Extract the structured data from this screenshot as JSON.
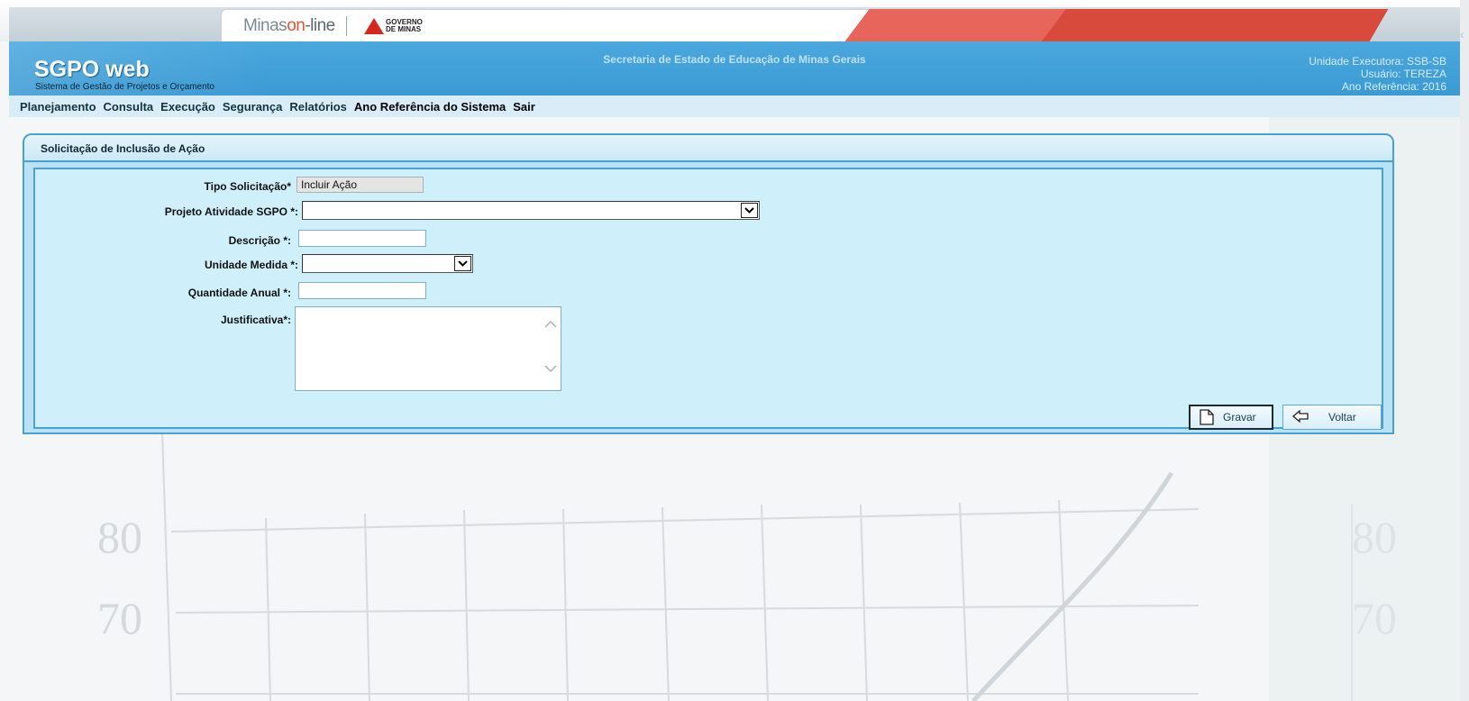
{
  "banner": {
    "portal_logo_left": "Minas",
    "portal_logo_mid": "on",
    "portal_logo_right": "-line",
    "gov_logo_line1": "GOVERNO",
    "gov_logo_line2": "DE MINAS"
  },
  "header": {
    "app_title": "SGPO web",
    "app_subtitle": "Sistema de Gestão de Projetos e Orçamento",
    "organization": "Secretaria de Estado de Educação de Minas Gerais",
    "executing_unit": "Unidade Executora: SSB-SB",
    "user": "Usuário: TEREZA",
    "reference_year": "Ano Referência: 2016"
  },
  "menu": {
    "items": [
      "Planejamento",
      "Consulta",
      "Execução",
      "Segurança",
      "Relatórios",
      "Ano Referência do Sistema",
      "Sair"
    ]
  },
  "form": {
    "title": "Solicitação de Inclusão de Ação",
    "request_type_label": "Tipo Solicitação*",
    "request_type_value": "Incluir Ação",
    "project_label": "Projeto Atividade SGPO *:",
    "project_value": "",
    "description_label": "Descrição *:",
    "description_value": "",
    "unit_label": "Unidade Medida *:",
    "unit_value": "",
    "annual_qty_label": "Quantidade Anual *:",
    "annual_qty_value": "",
    "justification_label": "Justificativa*:",
    "justification_value": "",
    "save_button": "Gravar",
    "back_button": "Voltar"
  },
  "background": {
    "chart_tick_80": "80",
    "chart_tick_70": "70"
  },
  "colors": {
    "header_blue": "#3c9ad3",
    "panel_border": "#4a9fd3",
    "panel_bg": "#cff0fb",
    "banner_red": "#d84a3c"
  }
}
